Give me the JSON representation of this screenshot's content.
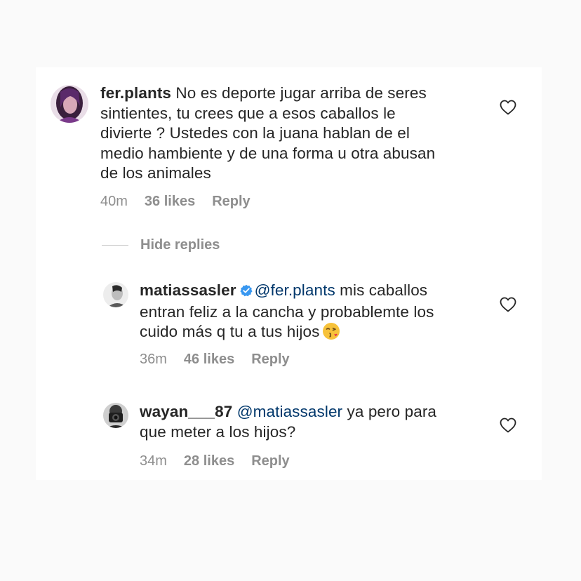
{
  "comment": {
    "username": "fer.plants",
    "lines": [
      " No es deporte jugar arriba de seres",
      "sintientes, tu crees que a esos caballos le",
      "divierte ? Ustedes con la juana hablan de el",
      "medio hambiente y de una forma u otra abusan",
      "de los animales"
    ],
    "time": "40m",
    "likes": "36 likes",
    "reply_label": "Reply"
  },
  "hide_replies_label": "Hide replies",
  "replies": [
    {
      "username": "matiassasler",
      "verified": true,
      "mention": "@fer.plants",
      "line1_rest": " mis caballos",
      "line2": "entran feliz a la cancha y probablemte los",
      "line3": "cuido más q tu a tus hijos",
      "time": "36m",
      "likes": "46 likes",
      "reply_label": "Reply"
    },
    {
      "username": "wayan___87",
      "mention": "@matiassasler",
      "line1_rest": " ya pero para",
      "line2": "que meter a los hijos?",
      "time": "34m",
      "likes": "28 likes",
      "reply_label": "Reply"
    }
  ],
  "colors": {
    "text": "#262626",
    "secondary": "#8e8e8e",
    "mention": "#00376b",
    "verified": "#3897f0"
  },
  "icons": {
    "like": "heart-outline-icon",
    "verified": "verified-badge-icon",
    "emoji": "face-blowing-kiss-emoji"
  }
}
